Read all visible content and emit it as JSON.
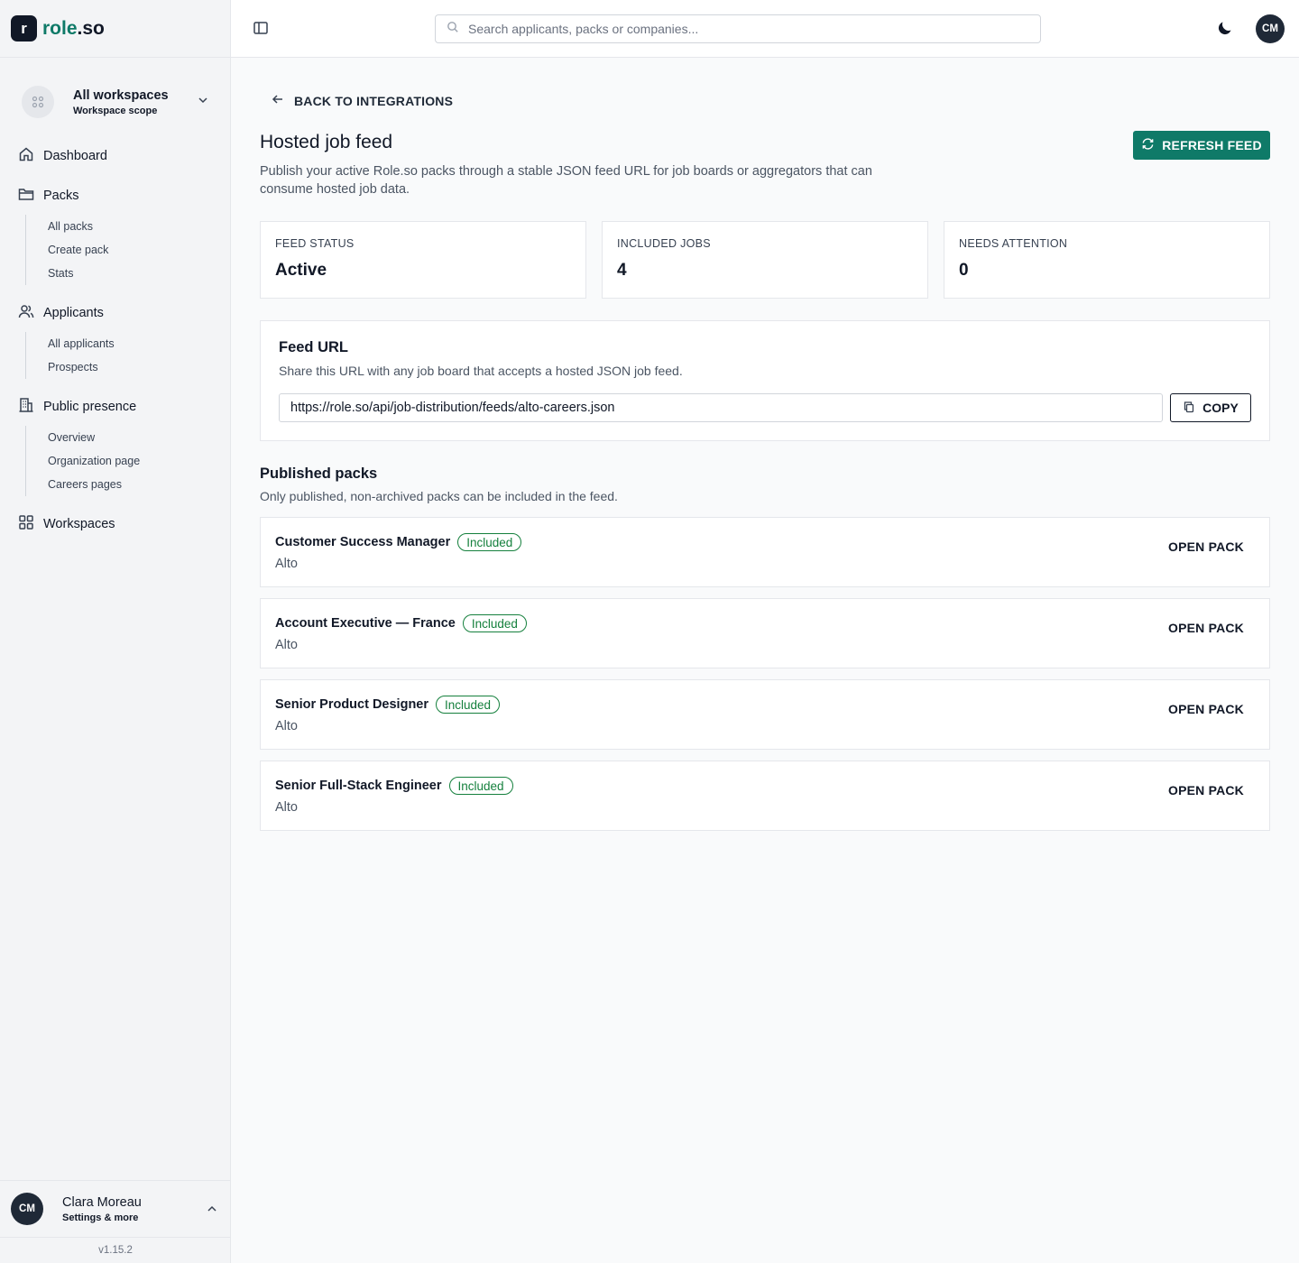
{
  "brand": {
    "mark": "r",
    "name_a": "role",
    "name_b": ".so"
  },
  "workspace": {
    "title": "All workspaces",
    "subtitle": "Workspace scope"
  },
  "nav": {
    "dashboard": "Dashboard",
    "packs": "Packs",
    "packs_sub": [
      "All packs",
      "Create pack",
      "Stats"
    ],
    "applicants": "Applicants",
    "applicants_sub": [
      "All applicants",
      "Prospects"
    ],
    "public_presence": "Public presence",
    "public_sub": [
      "Overview",
      "Organization page",
      "Careers pages"
    ],
    "workspaces": "Workspaces"
  },
  "user": {
    "initials": "CM",
    "name": "Clara Moreau",
    "subtitle": "Settings & more"
  },
  "version": "v1.15.2",
  "topbar": {
    "search_placeholder": "Search applicants, packs or companies...",
    "avatar_initials": "CM"
  },
  "page": {
    "back_label": "BACK TO INTEGRATIONS",
    "title": "Hosted job feed",
    "description": "Publish your active Role.so packs through a stable JSON feed URL for job boards or aggregators that can consume hosted job data.",
    "refresh_label": "REFRESH FEED"
  },
  "stats": [
    {
      "label": "FEED STATUS",
      "value": "Active"
    },
    {
      "label": "INCLUDED JOBS",
      "value": "4"
    },
    {
      "label": "NEEDS ATTENTION",
      "value": "0"
    }
  ],
  "feed": {
    "title": "Feed URL",
    "description": "Share this URL with any job board that accepts a hosted JSON job feed.",
    "url": "https://role.so/api/job-distribution/feeds/alto-careers.json",
    "copy_label": "COPY"
  },
  "published": {
    "title": "Published packs",
    "description": "Only published, non-archived packs can be included in the feed.",
    "open_label": "OPEN PACK",
    "packs": [
      {
        "title": "Customer Success Manager",
        "badge": "Included",
        "company": "Alto"
      },
      {
        "title": "Account Executive — France",
        "badge": "Included",
        "company": "Alto"
      },
      {
        "title": "Senior Product Designer",
        "badge": "Included",
        "company": "Alto"
      },
      {
        "title": "Senior Full-Stack Engineer",
        "badge": "Included",
        "company": "Alto"
      }
    ]
  },
  "colors": {
    "accent": "#0f7a68",
    "included": "#15803d",
    "dark": "#111827"
  }
}
